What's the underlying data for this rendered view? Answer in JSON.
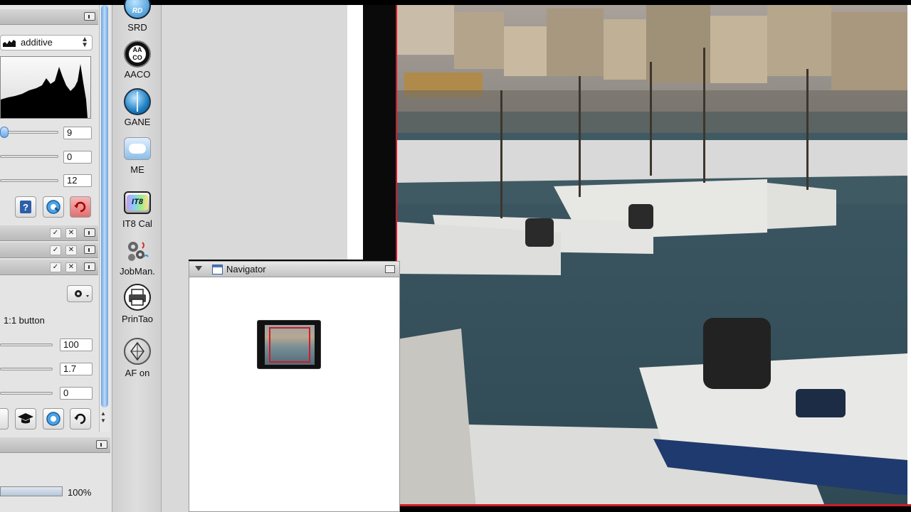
{
  "left_panel": {
    "dropdown_value": "additive",
    "sliders": [
      {
        "name": "slider-1",
        "value": "9"
      },
      {
        "name": "slider-2",
        "value": "0"
      },
      {
        "name": "slider-3",
        "value": "12"
      }
    ],
    "oneone_label": "1:1 button",
    "sharpen": [
      {
        "name": "sharpen-1",
        "value": "100"
      },
      {
        "name": "sharpen-2",
        "value": "1.7"
      },
      {
        "name": "sharpen-3",
        "value": "0"
      }
    ],
    "progress_percent": "100%",
    "progress_value": 1.0
  },
  "toolbar": {
    "items": [
      {
        "label": "SRD",
        "icon": "srd-icon"
      },
      {
        "label": "AACO",
        "icon": "aaco-icon"
      },
      {
        "label": "GANE",
        "icon": "gane-icon"
      },
      {
        "label": "ME",
        "icon": "me-icon"
      },
      {
        "label": "IT8 Cal",
        "icon": "it8-icon"
      },
      {
        "label": "JobMan.",
        "icon": "jobman-icon"
      },
      {
        "label": "PrinTao",
        "icon": "printao-icon"
      },
      {
        "label": "AF on",
        "icon": "af-icon"
      }
    ],
    "icon_text": {
      "srd": "RD",
      "aaco_top": "AA",
      "aaco_bottom": "CO",
      "it8": "IT8"
    }
  },
  "navigator": {
    "title": "Navigator"
  },
  "colors": {
    "accent_red": "#d01b2a",
    "accent_blue": "#5b9de0"
  }
}
